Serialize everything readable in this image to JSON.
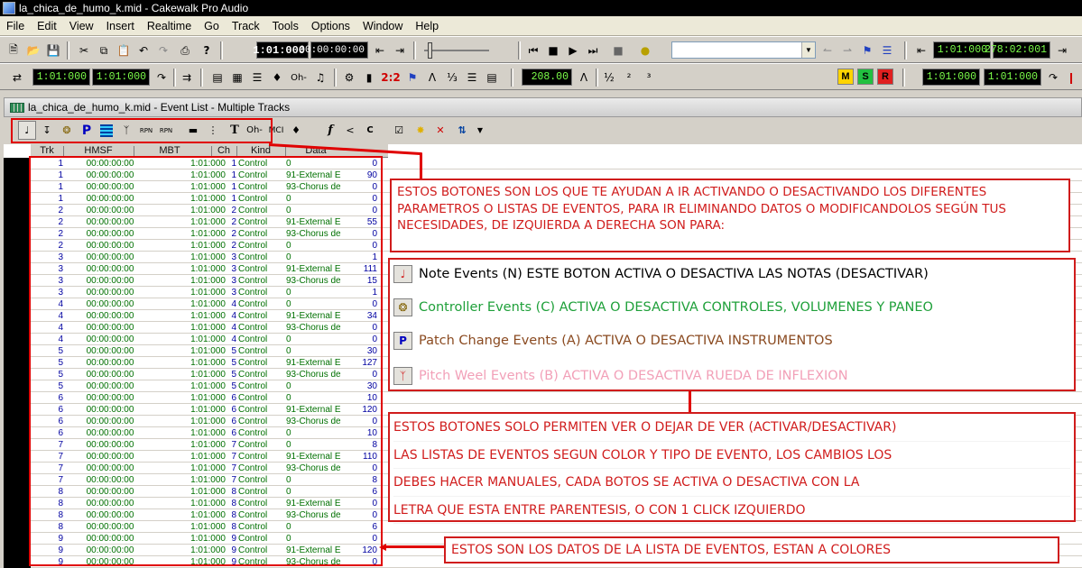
{
  "window": {
    "title": "la_chica_de_humo_k.mid - Cakewalk Pro Audio"
  },
  "menu": [
    "File",
    "Edit",
    "View",
    "Insert",
    "Realtime",
    "Go",
    "Track",
    "Tools",
    "Options",
    "Window",
    "Help"
  ],
  "transport": {
    "now_time_mbt": "1:01:000",
    "now_time_smpte": "00:00:00:00",
    "from_time": "1:01:000",
    "thru_time": "278:02:001",
    "tempo": "208.00",
    "loop_from": "1:01:000",
    "loop_thru": "1:01:000",
    "punch_from": "1:01:000",
    "punch_thru": "1:01:000",
    "meter_m": "M",
    "meter_s": "S",
    "meter_r": "R",
    "ratio_label": "2:2"
  },
  "child_window": {
    "title": "la_chica_de_humo_k.mid - Event List - Multiple Tracks"
  },
  "event_toolbar": {
    "text_t": "T",
    "mci": "MCI",
    "f": "f",
    "c": "C",
    "rpn": "RPN",
    "nrpn": "RPN",
    "sysx": "Oh-"
  },
  "columns": [
    "Trk",
    "HMSF",
    "MBT",
    "Ch",
    "Kind",
    "Data"
  ],
  "events": [
    {
      "trk": "1",
      "hmsf": "00:00:00:00",
      "mbt": "1:01:000",
      "ch": "1",
      "kind": "Control",
      "data": "0",
      "val": "0"
    },
    {
      "trk": "1",
      "hmsf": "00:00:00:00",
      "mbt": "1:01:000",
      "ch": "1",
      "kind": "Control",
      "data": "91-External E",
      "val": "90"
    },
    {
      "trk": "1",
      "hmsf": "00:00:00:00",
      "mbt": "1:01:000",
      "ch": "1",
      "kind": "Control",
      "data": "93-Chorus de",
      "val": "0"
    },
    {
      "trk": "1",
      "hmsf": "00:00:00:00",
      "mbt": "1:01:000",
      "ch": "1",
      "kind": "Control",
      "data": "0",
      "val": "0"
    },
    {
      "trk": "2",
      "hmsf": "00:00:00:00",
      "mbt": "1:01:000",
      "ch": "2",
      "kind": "Control",
      "data": "0",
      "val": "0"
    },
    {
      "trk": "2",
      "hmsf": "00:00:00:00",
      "mbt": "1:01:000",
      "ch": "2",
      "kind": "Control",
      "data": "91-External E",
      "val": "55"
    },
    {
      "trk": "2",
      "hmsf": "00:00:00:00",
      "mbt": "1:01:000",
      "ch": "2",
      "kind": "Control",
      "data": "93-Chorus de",
      "val": "0"
    },
    {
      "trk": "2",
      "hmsf": "00:00:00:00",
      "mbt": "1:01:000",
      "ch": "2",
      "kind": "Control",
      "data": "0",
      "val": "0"
    },
    {
      "trk": "3",
      "hmsf": "00:00:00:00",
      "mbt": "1:01:000",
      "ch": "3",
      "kind": "Control",
      "data": "0",
      "val": "1"
    },
    {
      "trk": "3",
      "hmsf": "00:00:00:00",
      "mbt": "1:01:000",
      "ch": "3",
      "kind": "Control",
      "data": "91-External E",
      "val": "111"
    },
    {
      "trk": "3",
      "hmsf": "00:00:00:00",
      "mbt": "1:01:000",
      "ch": "3",
      "kind": "Control",
      "data": "93-Chorus de",
      "val": "15"
    },
    {
      "trk": "3",
      "hmsf": "00:00:00:00",
      "mbt": "1:01:000",
      "ch": "3",
      "kind": "Control",
      "data": "0",
      "val": "1"
    },
    {
      "trk": "4",
      "hmsf": "00:00:00:00",
      "mbt": "1:01:000",
      "ch": "4",
      "kind": "Control",
      "data": "0",
      "val": "0"
    },
    {
      "trk": "4",
      "hmsf": "00:00:00:00",
      "mbt": "1:01:000",
      "ch": "4",
      "kind": "Control",
      "data": "91-External E",
      "val": "34"
    },
    {
      "trk": "4",
      "hmsf": "00:00:00:00",
      "mbt": "1:01:000",
      "ch": "4",
      "kind": "Control",
      "data": "93-Chorus de",
      "val": "0"
    },
    {
      "trk": "4",
      "hmsf": "00:00:00:00",
      "mbt": "1:01:000",
      "ch": "4",
      "kind": "Control",
      "data": "0",
      "val": "0"
    },
    {
      "trk": "5",
      "hmsf": "00:00:00:00",
      "mbt": "1:01:000",
      "ch": "5",
      "kind": "Control",
      "data": "0",
      "val": "30"
    },
    {
      "trk": "5",
      "hmsf": "00:00:00:00",
      "mbt": "1:01:000",
      "ch": "5",
      "kind": "Control",
      "data": "91-External E",
      "val": "127"
    },
    {
      "trk": "5",
      "hmsf": "00:00:00:00",
      "mbt": "1:01:000",
      "ch": "5",
      "kind": "Control",
      "data": "93-Chorus de",
      "val": "0"
    },
    {
      "trk": "5",
      "hmsf": "00:00:00:00",
      "mbt": "1:01:000",
      "ch": "5",
      "kind": "Control",
      "data": "0",
      "val": "30"
    },
    {
      "trk": "6",
      "hmsf": "00:00:00:00",
      "mbt": "1:01:000",
      "ch": "6",
      "kind": "Control",
      "data": "0",
      "val": "10"
    },
    {
      "trk": "6",
      "hmsf": "00:00:00:00",
      "mbt": "1:01:000",
      "ch": "6",
      "kind": "Control",
      "data": "91-External E",
      "val": "120"
    },
    {
      "trk": "6",
      "hmsf": "00:00:00:00",
      "mbt": "1:01:000",
      "ch": "6",
      "kind": "Control",
      "data": "93-Chorus de",
      "val": "0"
    },
    {
      "trk": "6",
      "hmsf": "00:00:00:00",
      "mbt": "1:01:000",
      "ch": "6",
      "kind": "Control",
      "data": "0",
      "val": "10"
    },
    {
      "trk": "7",
      "hmsf": "00:00:00:00",
      "mbt": "1:01:000",
      "ch": "7",
      "kind": "Control",
      "data": "0",
      "val": "8"
    },
    {
      "trk": "7",
      "hmsf": "00:00:00:00",
      "mbt": "1:01:000",
      "ch": "7",
      "kind": "Control",
      "data": "91-External E",
      "val": "110"
    },
    {
      "trk": "7",
      "hmsf": "00:00:00:00",
      "mbt": "1:01:000",
      "ch": "7",
      "kind": "Control",
      "data": "93-Chorus de",
      "val": "0"
    },
    {
      "trk": "7",
      "hmsf": "00:00:00:00",
      "mbt": "1:01:000",
      "ch": "7",
      "kind": "Control",
      "data": "0",
      "val": "8"
    },
    {
      "trk": "8",
      "hmsf": "00:00:00:00",
      "mbt": "1:01:000",
      "ch": "8",
      "kind": "Control",
      "data": "0",
      "val": "6"
    },
    {
      "trk": "8",
      "hmsf": "00:00:00:00",
      "mbt": "1:01:000",
      "ch": "8",
      "kind": "Control",
      "data": "91-External E",
      "val": "0"
    },
    {
      "trk": "8",
      "hmsf": "00:00:00:00",
      "mbt": "1:01:000",
      "ch": "8",
      "kind": "Control",
      "data": "93-Chorus de",
      "val": "0"
    },
    {
      "trk": "8",
      "hmsf": "00:00:00:00",
      "mbt": "1:01:000",
      "ch": "8",
      "kind": "Control",
      "data": "0",
      "val": "6"
    },
    {
      "trk": "9",
      "hmsf": "00:00:00:00",
      "mbt": "1:01:000",
      "ch": "9",
      "kind": "Control",
      "data": "0",
      "val": "0"
    },
    {
      "trk": "9",
      "hmsf": "00:00:00:00",
      "mbt": "1:01:000",
      "ch": "9",
      "kind": "Control",
      "data": "91-External E",
      "val": "120"
    },
    {
      "trk": "9",
      "hmsf": "00:00:00:00",
      "mbt": "1:01:000",
      "ch": "9",
      "kind": "Control",
      "data": "93-Chorus de",
      "val": "0"
    }
  ],
  "row_colors": {
    "trk": "#0000a0",
    "time": "#007000",
    "kind": "#007000",
    "accent": "#d01c1c"
  },
  "annotations": {
    "intro": "ESTOS BOTONES SON LOS QUE TE AYUDAN A IR ACTIVANDO O DESACTIVANDO LOS DIFERENTES PARAMETROS O LISTAS DE EVENTOS, PARA IR ELIMINANDO DATOS O MODIFICANDOLOS SEGÚN TUS NECESIDADES, DE IZQUIERDA A DERECHA SON PARA:",
    "legend": [
      {
        "icon": "note-icon",
        "text": "Note Events (N) ESTE BOTON ACTIVA O DESACTIVA LAS NOTAS (DESACTIVAR)",
        "color": "#000000"
      },
      {
        "icon": "controller-icon",
        "text": "Controller Events (C) ACTIVA O DESACTIVA CONTROLES, VOLUMENES Y PANEO",
        "color": "#1fa03a"
      },
      {
        "icon": "patch-icon",
        "text": "Patch Change Events (A) ACTIVA O DESACTIVA INSTRUMENTOS",
        "color": "#8a4a20"
      },
      {
        "icon": "pitch-wheel-icon",
        "text": "Pitch Weel Events (B) ACTIVA O DESACTIVA RUEDA DE INFLEXION",
        "color": "#f2a0b8"
      }
    ],
    "view_note": [
      "ESTOS BOTONES SOLO PERMITEN VER O DEJAR DE VER (ACTIVAR/DESACTIVAR)",
      "LAS LISTAS DE EVENTOS SEGUN COLOR Y TIPO DE EVENTO, LOS CAMBIOS LOS",
      "DEBES HACER MANUALES,  CADA BOTOS SE ACTIVA O DESACTIVA CON LA",
      "LETRA QUE ESTA ENTRE PARENTESIS,  O CON 1 CLICK IZQUIERDO"
    ],
    "data_note": "ESTOS SON LOS DATOS DE LA LISTA DE EVENTOS,  ESTAN A COLORES"
  }
}
